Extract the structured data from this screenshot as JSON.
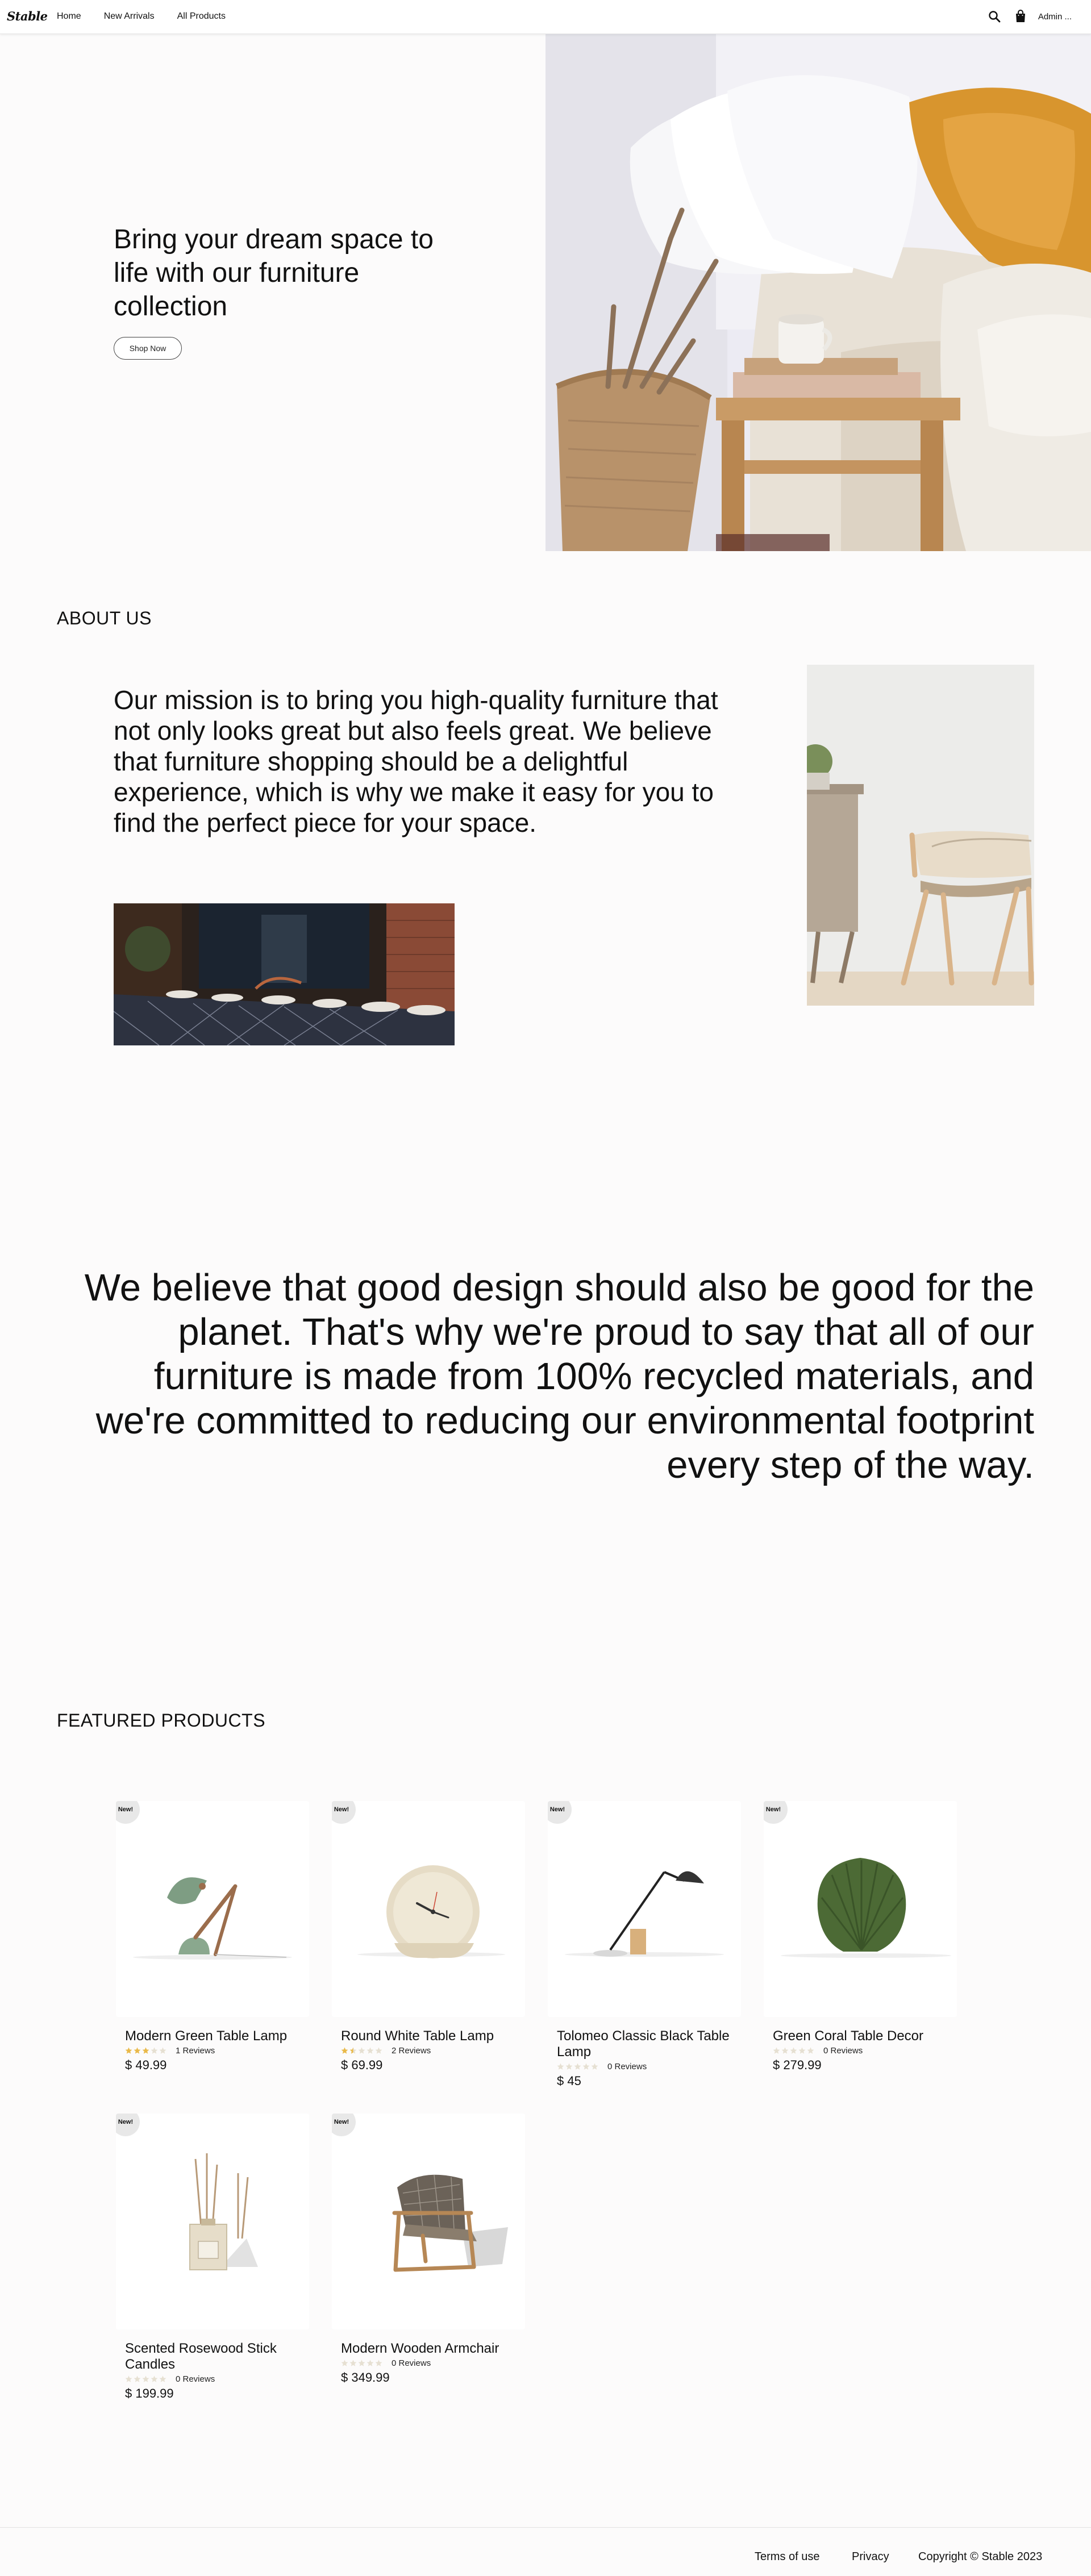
{
  "nav": {
    "logo": "Stable",
    "links": [
      "Home",
      "New Arrivals",
      "All Products"
    ],
    "user": "Admin ..."
  },
  "hero": {
    "title": "Bring your dream space to life with our furniture collection",
    "button": "Shop Now"
  },
  "about": {
    "heading": "ABOUT US",
    "text": "Our mission is to bring you high-quality furniture that not only looks great but also feels great. We believe that furniture shopping should be a delightful experience, which is why we make it easy for you to find the perfect piece for your space."
  },
  "belief": {
    "text": "We believe that good design should also be good for the planet. That's why we're proud to say that all of our furniture is made from 100% recycled materials, and we're committed to reducing our environmental footprint every step of the way."
  },
  "featured": {
    "heading": "FEATURED PRODUCTS",
    "badge": "New!",
    "products": [
      {
        "name": "Modern Green Table Lamp",
        "rating": 3,
        "reviews": "1 Reviews",
        "price": "$ 49.99",
        "icon": "table-lamp-icon"
      },
      {
        "name": "Round White Table Lamp",
        "rating": 1.5,
        "reviews": "2 Reviews",
        "price": "$ 69.99",
        "icon": "clock-lamp-icon"
      },
      {
        "name": "Tolomeo Classic Black Table Lamp",
        "rating": 0,
        "reviews": "0 Reviews",
        "price": "$ 45",
        "icon": "desk-lamp-icon"
      },
      {
        "name": "Green Coral Table Decor",
        "rating": 0,
        "reviews": "0 Reviews",
        "price": "$ 279.99",
        "icon": "shell-decor-icon"
      },
      {
        "name": "Scented Rosewood Stick Candles",
        "rating": 0,
        "reviews": "0 Reviews",
        "price": "$ 199.99",
        "icon": "diffuser-icon"
      },
      {
        "name": "Modern Wooden Armchair",
        "rating": 0,
        "reviews": "0 Reviews",
        "price": "$ 349.99",
        "icon": "armchair-icon"
      }
    ]
  },
  "footer": {
    "terms": "Terms of use",
    "privacy": "Privacy",
    "copyright": "Copyright © Stable 2023"
  },
  "colors": {
    "background": "#fcfbfb",
    "star_filled": "#e9b949",
    "star_empty": "#e6e0d2",
    "badge": "#e8e8e8"
  }
}
